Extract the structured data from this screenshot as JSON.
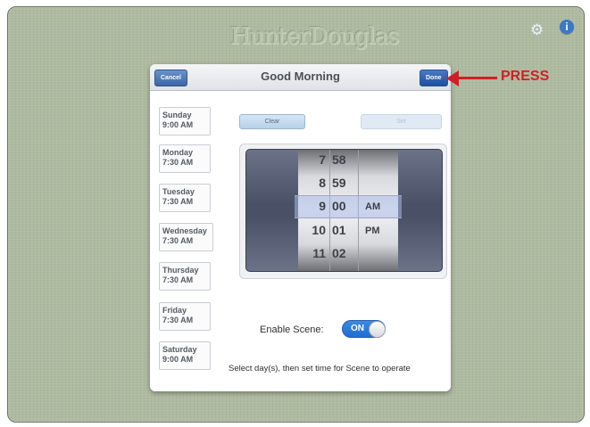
{
  "app": {
    "logo": "HunterDouglas"
  },
  "header_icons": {
    "settings": "gear-icon",
    "info": "info-icon",
    "info_glyph": "i"
  },
  "modal": {
    "title": "Good Morning",
    "cancel_label": "Cancel",
    "done_label": "Done"
  },
  "days": [
    {
      "day": "Sunday",
      "time": "9:00 AM"
    },
    {
      "day": "Monday",
      "time": "7:30 AM"
    },
    {
      "day": "Tuesday",
      "time": "7:30 AM"
    },
    {
      "day": "Wednesday",
      "time": "7:30 AM"
    },
    {
      "day": "Thursday",
      "time": "7:30 AM"
    },
    {
      "day": "Friday",
      "time": "7:30 AM"
    },
    {
      "day": "Saturday",
      "time": "9:00 AM"
    }
  ],
  "actions": {
    "clear_label": "Clear",
    "set_label": "Set"
  },
  "picker": {
    "hours": [
      "7",
      "8",
      "9",
      "10",
      "11"
    ],
    "minutes": [
      "58",
      "59",
      "00",
      "01",
      "02"
    ],
    "ampm": [
      "AM",
      "PM"
    ],
    "selected": {
      "hour": "9",
      "minute": "00",
      "ampm": "AM"
    }
  },
  "scene": {
    "enable_label": "Enable Scene:",
    "toggle_label": "ON",
    "enabled": true,
    "hint": "Select day(s), then set time for Scene to operate"
  },
  "annotation": {
    "text": "PRESS",
    "color": "#d21f26"
  }
}
